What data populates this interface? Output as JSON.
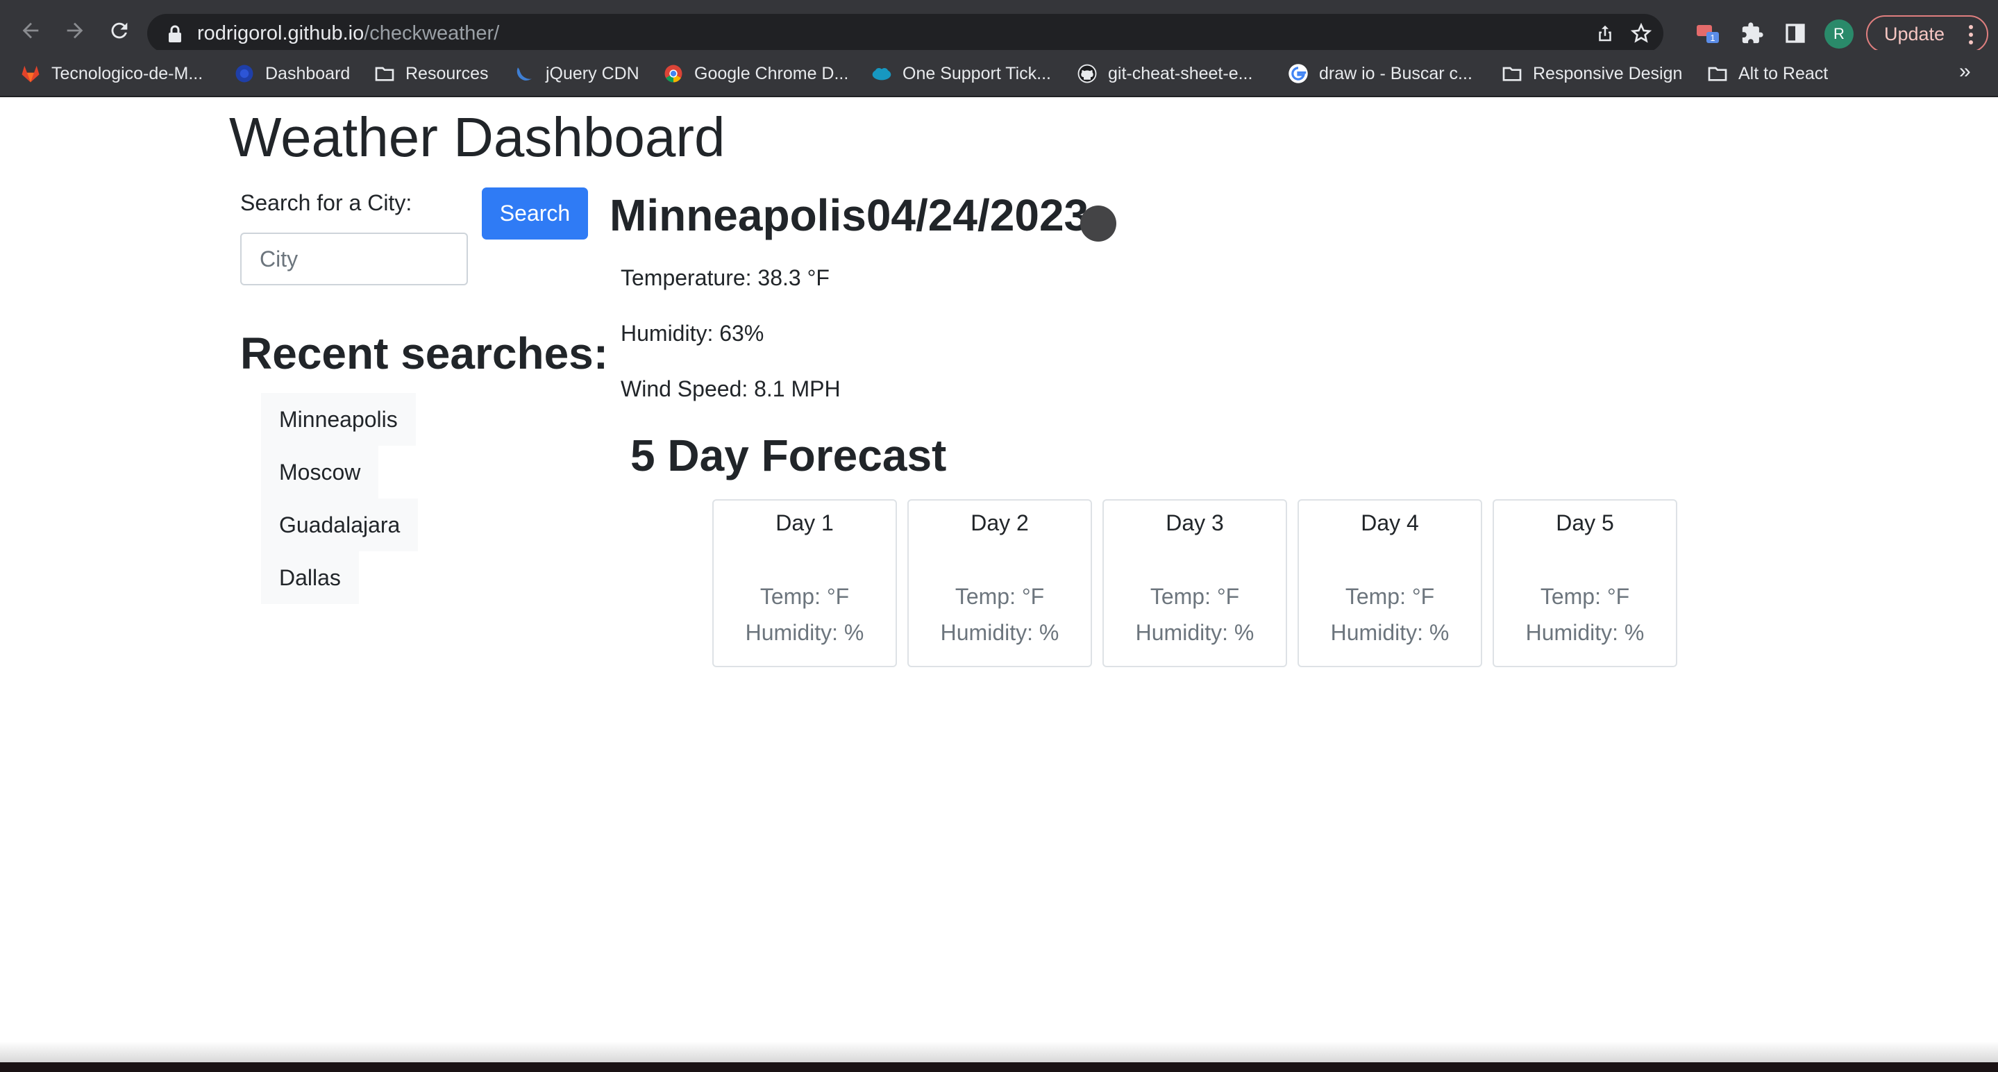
{
  "browser": {
    "url_host": "rodrigorol.github.io",
    "url_path": "/checkweather/",
    "update_label": "Update",
    "profile_initial": "R",
    "extension_badge": "1",
    "bookmarks_more": "»",
    "bookmarks": [
      {
        "label": "Tecnologico-de-M...",
        "icon": "gitlab-icon"
      },
      {
        "label": "Dashboard",
        "icon": "dashboard-icon"
      },
      {
        "label": "Resources",
        "icon": "folder-icon"
      },
      {
        "label": "jQuery CDN",
        "icon": "jquery-icon"
      },
      {
        "label": "Google Chrome D...",
        "icon": "chrome-icon"
      },
      {
        "label": "One Support Tick...",
        "icon": "salesforce-icon"
      },
      {
        "label": "git-cheat-sheet-e...",
        "icon": "github-icon"
      },
      {
        "label": "draw io - Buscar c...",
        "icon": "google-icon"
      },
      {
        "label": "Responsive Design",
        "icon": "folder-icon"
      },
      {
        "label": "Alt to React",
        "icon": "folder-icon"
      }
    ]
  },
  "page": {
    "title": "Weather Dashboard",
    "search": {
      "label": "Search for a City:",
      "placeholder": "City",
      "value": "",
      "button_label": "Search"
    },
    "recent": {
      "title": "Recent searches:",
      "items": [
        "Minneapolis",
        "Moscow",
        "Guadalajara",
        "Dallas"
      ]
    },
    "current": {
      "heading": "Minneapolis04/24/2023",
      "temperature": "Temperature: 38.3 °F",
      "humidity": "Humidity: 63%",
      "wind": "Wind Speed: 8.1 MPH",
      "icon": "weather-icon"
    },
    "forecast": {
      "title": "5 Day Forecast",
      "days": [
        {
          "label": "Day 1",
          "temp": "Temp: °F",
          "humidity": "Humidity: %"
        },
        {
          "label": "Day 2",
          "temp": "Temp: °F",
          "humidity": "Humidity: %"
        },
        {
          "label": "Day 3",
          "temp": "Temp: °F",
          "humidity": "Humidity: %"
        },
        {
          "label": "Day 4",
          "temp": "Temp: °F",
          "humidity": "Humidity: %"
        },
        {
          "label": "Day 5",
          "temp": "Temp: °F",
          "humidity": "Humidity: %"
        }
      ]
    }
  },
  "colors": {
    "chrome_bg": "#35363a",
    "omnibox_bg": "#202124",
    "primary_button": "#2f7bf5",
    "text": "#212529",
    "muted_text": "#6c757d",
    "card_border": "#dee2e6",
    "recent_item_bg": "#f8f9fa"
  }
}
